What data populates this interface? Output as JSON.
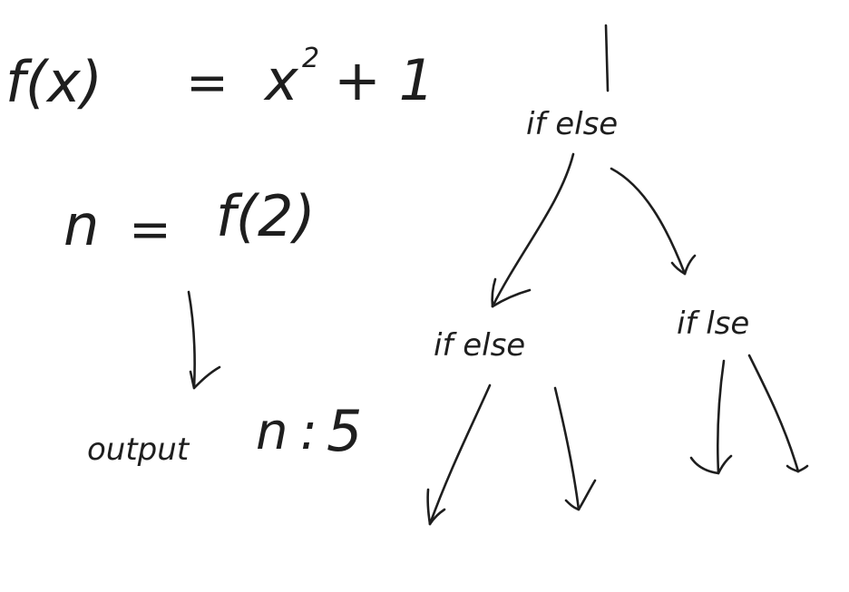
{
  "function_definition": {
    "lhs": "f(x)",
    "equals": "=",
    "base": "x",
    "exponent": "2",
    "rest": "+ 1"
  },
  "assignment": {
    "lhs": "n",
    "equals": "=",
    "rhs": "f(2)"
  },
  "output": {
    "label": "output",
    "var": "n",
    "separator": ":",
    "value": "5"
  },
  "tree": {
    "root": "if else",
    "left_child": "if else",
    "right_child": "if lse"
  }
}
